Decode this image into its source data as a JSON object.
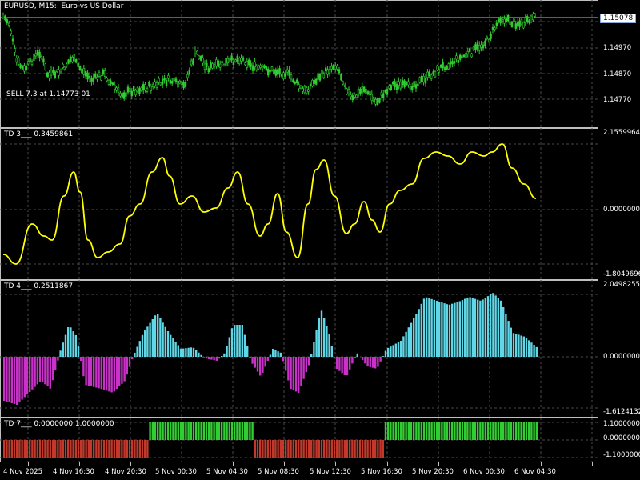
{
  "main_pane": {
    "title": "EURUSD, M15:  Euro vs US Dollar",
    "current_price": "1.15078",
    "trade_label": "SELL 7.3 at 1.14773 01",
    "price_labels": [
      "1.14970",
      "1.14870",
      "1.14770"
    ]
  },
  "td3_pane": {
    "title": "TD 3___ 0.3459861",
    "labels": [
      "2.1559964",
      "0.0000000",
      "-1.8049696"
    ]
  },
  "td4_pane": {
    "title": "TD 4___ 0.2511867",
    "labels": [
      "2.0498255",
      "0.0000000",
      "-1.6124132"
    ]
  },
  "td7_pane": {
    "title": "TD 7___ 0.0000000 1.0000000",
    "labels": [
      "1.1000000",
      "0.0000000",
      "-1.1000000"
    ]
  },
  "time_axis": [
    "4 Nov 2025",
    "4 Nov 16:30",
    "4 Nov 20:30",
    "5 Nov 00:30",
    "5 Nov 04:30",
    "5 Nov 08:30",
    "5 Nov 12:30",
    "5 Nov 16:30",
    "5 Nov 20:30",
    "6 Nov 00:30",
    "6 Nov 04:30"
  ],
  "colors": {
    "candle": "#32cd32",
    "td3_line": "#ffff00",
    "td4_positive": "#5fd7e6",
    "td4_negative": "#c832c8",
    "td7_up": "#32cd32",
    "td7_down": "#c0392b",
    "price_line": "#80d0ff"
  }
}
